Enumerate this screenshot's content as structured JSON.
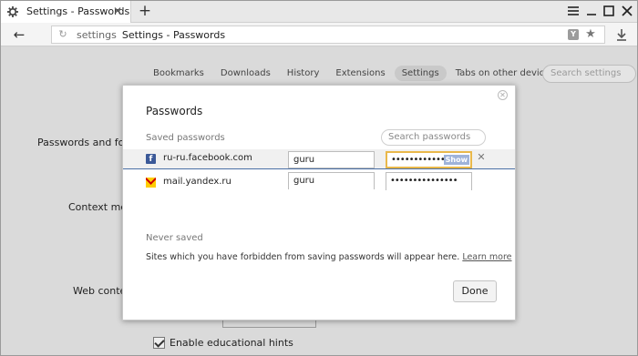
{
  "tab": {
    "title": "Settings - Passwords",
    "icon": "gear-icon"
  },
  "address_bar": {
    "host": "settings",
    "title": "Settings - Passwords"
  },
  "settings_nav": {
    "items": [
      {
        "label": "Bookmarks"
      },
      {
        "label": "Downloads"
      },
      {
        "label": "History"
      },
      {
        "label": "Extensions"
      },
      {
        "label": "Settings",
        "active": true
      },
      {
        "label": "Tabs on other devices"
      }
    ],
    "search_placeholder": "Search settings"
  },
  "background_sections": {
    "passwords_forms": "Passwords and forms",
    "context_menu": "Context menu",
    "web_content": "Web content",
    "educational_hints": "Enable educational hints"
  },
  "dialog": {
    "title": "Passwords",
    "saved_label": "Saved passwords",
    "search_placeholder": "Search passwords",
    "entries": [
      {
        "site": "ru-ru.facebook.com",
        "username": "guru",
        "password_mask": "•••••••••••••••",
        "show_label": "Show",
        "icon": "facebook-icon"
      },
      {
        "site": "mail.yandex.ru",
        "username": "guru",
        "password_mask": "•••••••••••••••",
        "icon": "yandex-mail-icon"
      }
    ],
    "never_saved_label": "Never saved",
    "never_saved_text": "Sites which you have forbidden from saving passwords will appear here.",
    "learn_more": "Learn more",
    "done_label": "Done"
  },
  "colors": {
    "accent": "#4a6fa5",
    "focus_border": "#e9b84a",
    "facebook": "#3b5998"
  }
}
